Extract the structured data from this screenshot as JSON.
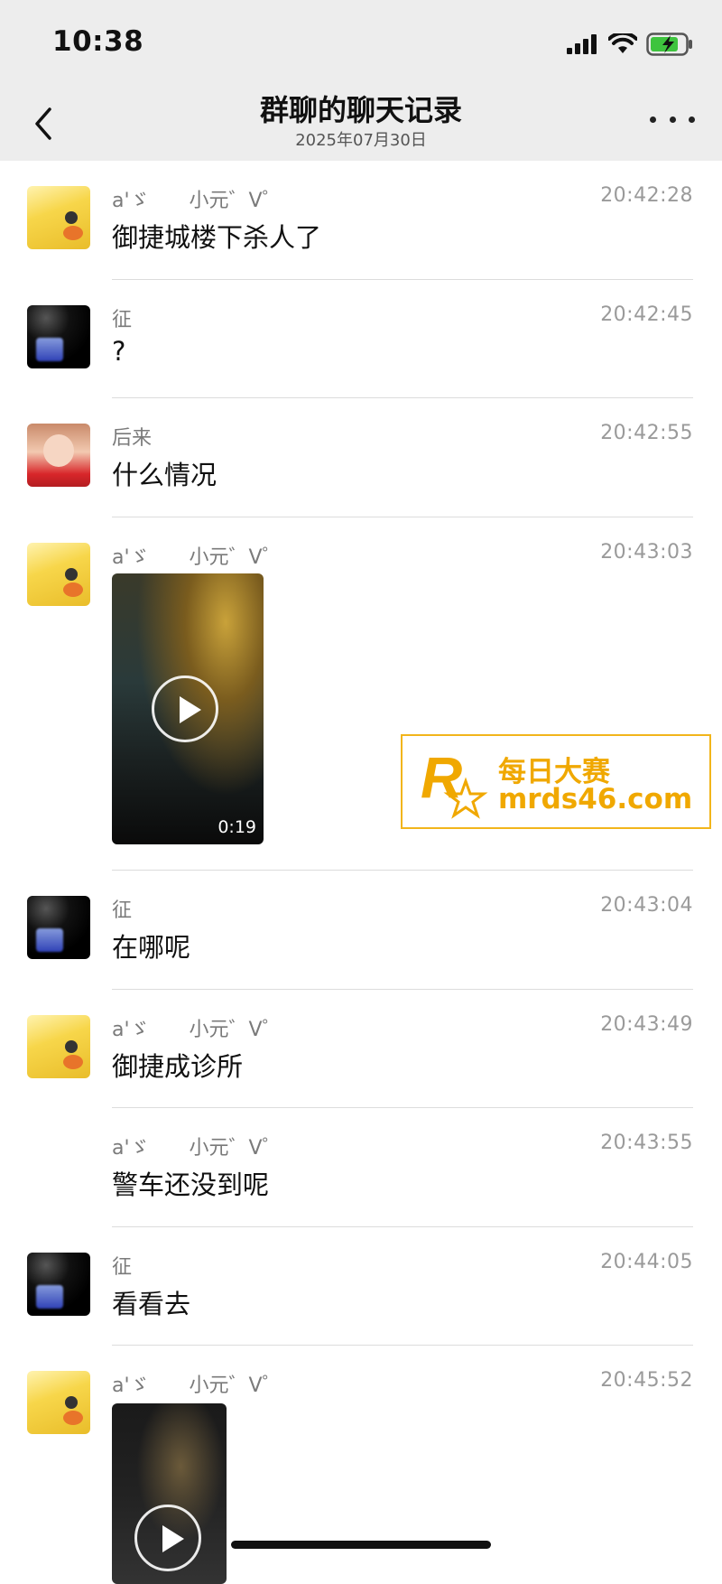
{
  "status_bar": {
    "time": "10:38"
  },
  "header": {
    "title": "群聊的聊天记录",
    "date": "2025年07月30日"
  },
  "messages": [
    {
      "sender": "a'ゞ　　小元゛V゜",
      "time": "20:42:28",
      "text": "御捷城楼下杀人了"
    },
    {
      "sender": "征",
      "time": "20:42:45",
      "text": "?"
    },
    {
      "sender": "后来",
      "time": "20:42:55",
      "text": "什么情况"
    },
    {
      "sender": "a'ゞ　　小元゛V゜",
      "time": "20:43:03",
      "video_duration": "0:19"
    },
    {
      "sender": "征",
      "time": "20:43:04",
      "text": "在哪呢"
    },
    {
      "sender": "a'ゞ　　小元゛V゜",
      "time": "20:43:49",
      "text": "御捷成诊所"
    },
    {
      "sender": "a'ゞ　　小元゛V゜",
      "time": "20:43:55",
      "text": "警车还没到呢"
    },
    {
      "sender": "征",
      "time": "20:44:05",
      "text": "看看去"
    },
    {
      "sender": "a'ゞ　　小元゛V゜",
      "time": "20:45:52"
    }
  ],
  "watermark": {
    "name": "每日大赛",
    "url": "mrds46.com"
  }
}
